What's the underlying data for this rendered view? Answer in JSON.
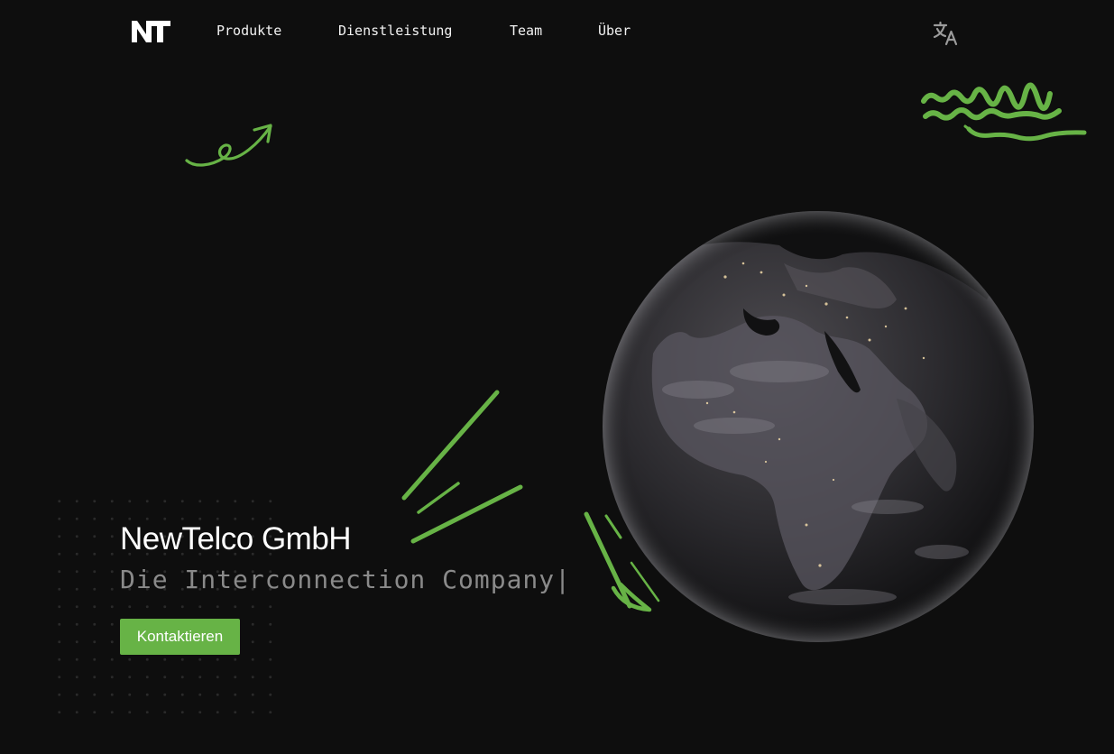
{
  "nav": {
    "logo_text": "NT",
    "items": [
      {
        "label": "Produkte"
      },
      {
        "label": "Dienstleistung"
      },
      {
        "label": "Team"
      },
      {
        "label": "Über"
      }
    ],
    "language_icon": "translate-icon"
  },
  "hero": {
    "title": "NewTelco GmbH",
    "subtitle": "Die Interconnection Company",
    "cursor": "|",
    "cta_label": "Kontaktieren"
  },
  "colors": {
    "background": "#0e0e0e",
    "accent": "#67b346",
    "nav_text": "#f2f2f2",
    "subtitle_text": "#8a8a8a"
  },
  "decorations": [
    "arrow-scribble-icon",
    "wave-scribble-icon",
    "slash-scribble-icon",
    "globe-image",
    "dot-grid"
  ]
}
